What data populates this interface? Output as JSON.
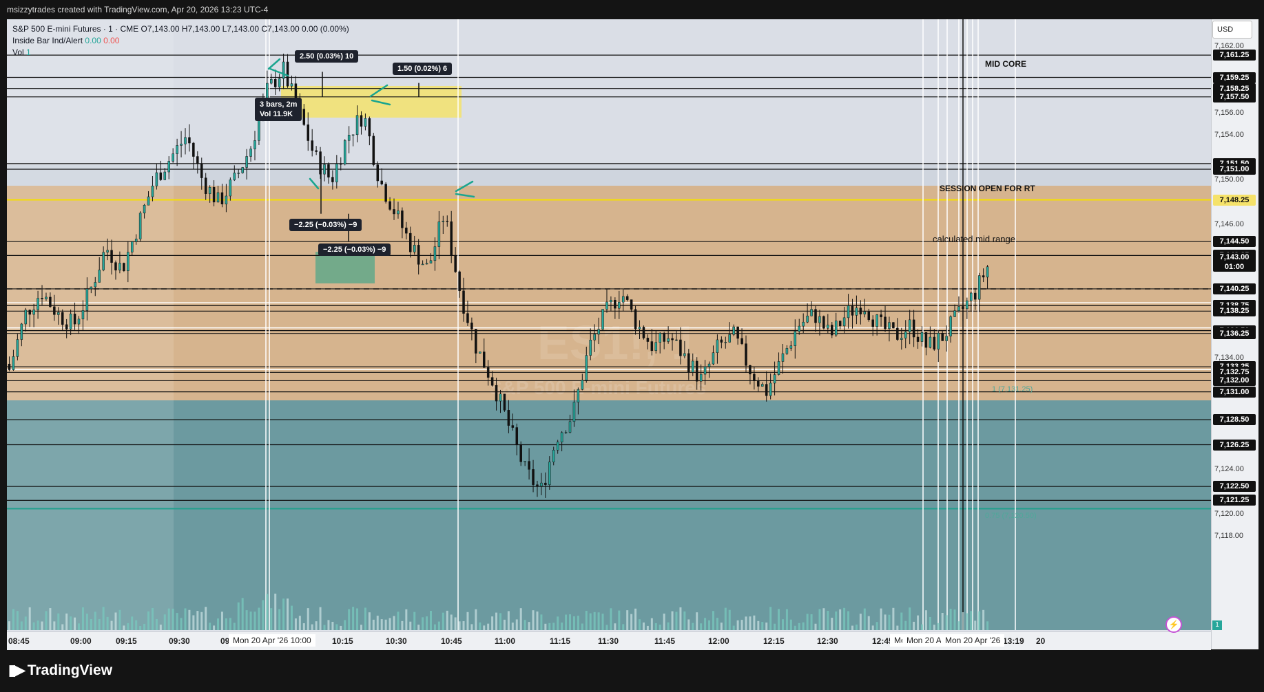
{
  "banner": "msizzytrades created with TradingView.com, Apr 20, 2026 13:23 UTC-4",
  "legend": {
    "symbol_line": "S&P 500 E-mini Futures · 1 · CME",
    "ohlc": "O7,143.00  H7,143.00  L7,143.00  C7,143.00  0.00 (0.00%)",
    "indicator_name": "Inside Bar Ind/Alert",
    "indicator_v1": "0.00",
    "indicator_v2": "0.00",
    "vol_name": "Vol",
    "vol_value": "1"
  },
  "currency": "USD",
  "price_ticks": [
    "7,162.00",
    "7,156.00",
    "7,154.00",
    "7,150.00",
    "7,146.00",
    "7,134.00",
    "7,124.00",
    "7,120.00",
    "7,118.00"
  ],
  "price_labels": [
    "7,161.25",
    "7,159.25",
    "7,158.25",
    "7,157.50",
    "7,151.50",
    "7,151.00",
    "7,144.50",
    "7,143.25",
    "7,140.25",
    "7,138.75",
    "7,138.25",
    "7,136.50",
    "7,136.25",
    "7,133.25",
    "7,132.75",
    "7,132.00",
    "7,131.00",
    "7,128.50",
    "7,126.25",
    "7,122.50",
    "7,121.25"
  ],
  "session_price": "7,148.25",
  "current_price": "7,143.00",
  "countdown": "01:00",
  "annotations": {
    "mid_core": "MID CORE",
    "session_open": "SESSION OPEN FOR RT",
    "calc_mid": "calculated mid range",
    "fib_right": "1 (7,131.25)",
    "fib_lower": "0.75 (7,120.50)"
  },
  "tooltips": {
    "t1": "2.50 (0.03%) 10",
    "t2": "1.50 (0.02%) 6",
    "t3": "−2.25 (−0.03%) −9",
    "t4": "−2.25 (−0.03%) −9",
    "bars_line1": "3 bars, 2m",
    "bars_line2": "Vol 11.9K"
  },
  "watermark": "ES1!, 1",
  "watermark_sub": "S&P 500 E-mini Futures",
  "time_labels": [
    "08:45",
    "09:00",
    "09:15",
    "09:30",
    "09",
    "10:15",
    "10:30",
    "10:45",
    "11:00",
    "11:15",
    "11:30",
    "11:45",
    "12:00",
    "12:15",
    "12:30",
    "12:45",
    "13:19",
    "20"
  ],
  "date_flags": [
    "Mon 20 Apr '26  10:00",
    "Mo",
    "Mon 20 A",
    "Mon 20 Apr '26"
  ],
  "footer_brand": "TradingView",
  "vol_badge": "1",
  "colors": {
    "up": "#26a69a",
    "down": "#ef5350",
    "zone_orange": "#deb887",
    "zone_teal": "#5f9ea0",
    "zone_yellow": "#f5e26a"
  }
}
